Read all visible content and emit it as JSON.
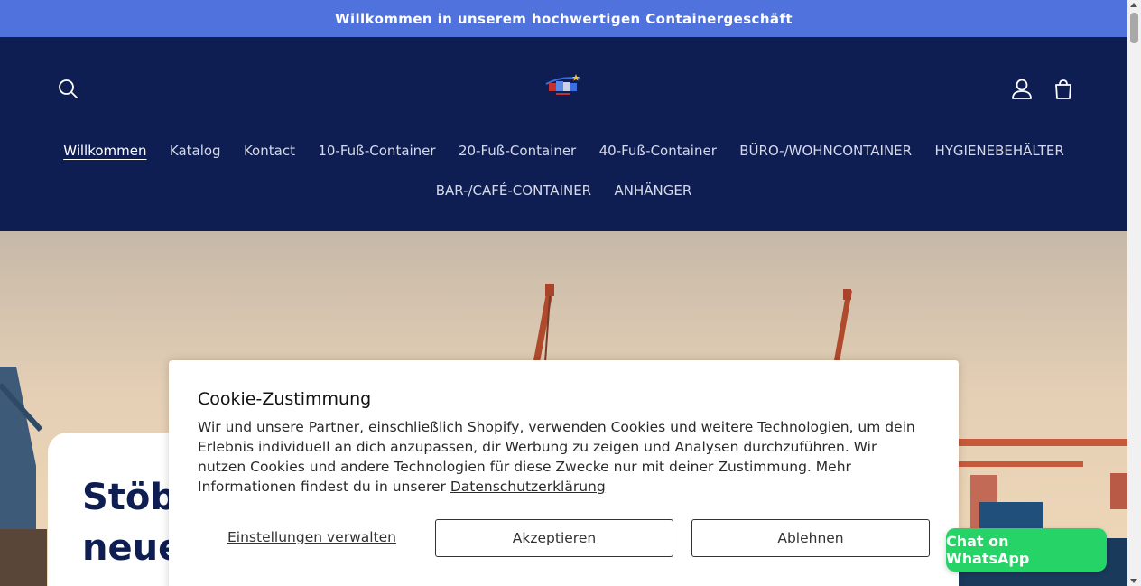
{
  "announcement": {
    "text": "Willkommen in unserem hochwertigen Containergeschäft"
  },
  "header": {
    "icons": {
      "search": "search-icon",
      "account": "account-icon",
      "cart": "cart-icon",
      "logo": "store-logo"
    },
    "nav": [
      {
        "label": "Willkommen",
        "active": true
      },
      {
        "label": "Katalog"
      },
      {
        "label": "Kontact"
      },
      {
        "label": "10-Fuß-Container"
      },
      {
        "label": "20-Fuß-Container"
      },
      {
        "label": "40-Fuß-Container"
      },
      {
        "label": "BÜRO-/WOHNCONTAINER"
      },
      {
        "label": "HYGIENEBEHÄLTER"
      },
      {
        "label": "BAR-/CAFÉ-CONTAINER"
      },
      {
        "label": "ANHÄNGER"
      }
    ]
  },
  "hero": {
    "title_line1": "Stöb",
    "title_line2": "neue"
  },
  "cookie": {
    "title": "Cookie-Zustimmung",
    "text": "Wir und unsere Partner, einschließlich Shopify, verwenden Cookies und weitere Technologien, um dein Erlebnis individuell an dich anzupassen, dir Werbung zu zeigen und Analysen durchzuführen. Wir nutzen Cookies und andere Technologien für diese Zwecke nur mit deiner Zustimmung. Mehr Informationen findest du in unserer",
    "link": "Datenschutzerklärung",
    "manage": "Einstellungen verwalten",
    "accept": "Akzeptieren",
    "decline": "Ablehnen"
  },
  "whatsapp": {
    "label": "Chat on WhatsApp"
  },
  "colors": {
    "announcement_bg": "#4f72dd",
    "header_bg": "#0e1d52",
    "whatsapp_green": "#25d366"
  }
}
